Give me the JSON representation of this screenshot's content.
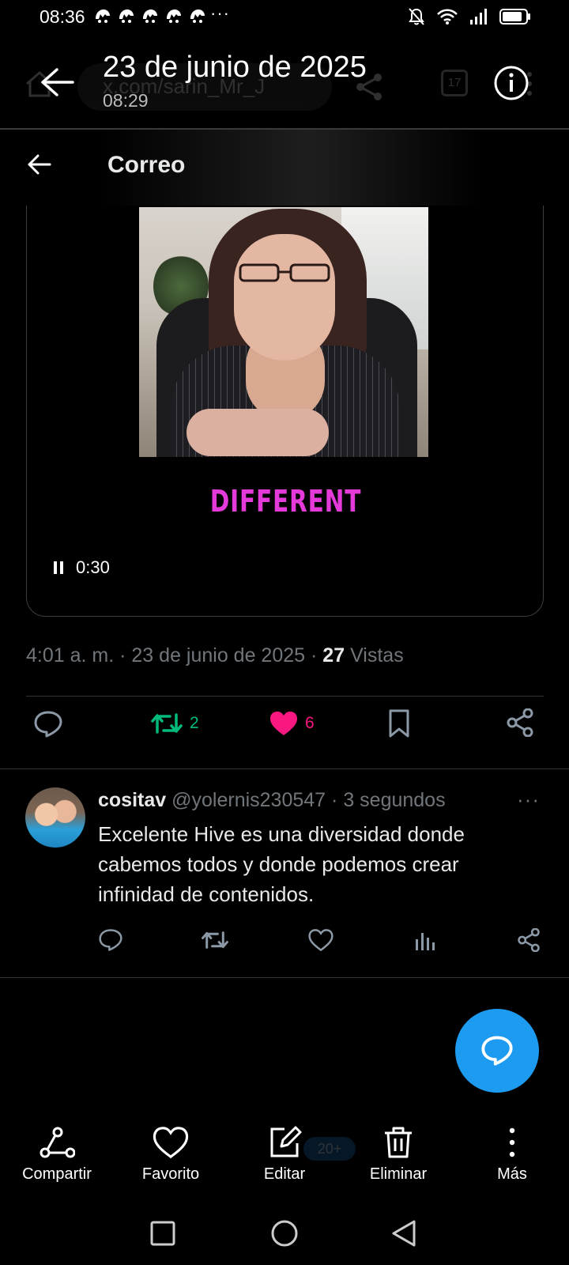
{
  "status_bar": {
    "time": "08:36",
    "more": "···"
  },
  "gallery_header": {
    "date": "23 de junio de 2025",
    "time": "08:29",
    "ghost_url": "x.com/sarin_Mr_J",
    "ghost_tab_count": "17"
  },
  "correo_bar": {
    "title": "Correo"
  },
  "video": {
    "caption": "DIFFERENT",
    "time": "0:30",
    "caption_color": "#e33ad9"
  },
  "tweet_meta": {
    "time": "4:01 a. m.",
    "separator": "·",
    "date": "23 de junio de 2025",
    "views_count": "27",
    "views_label": "Vistas"
  },
  "actions": {
    "retweets": "2",
    "likes": "6",
    "retweet_color": "#00ba7c",
    "like_color": "#f91880"
  },
  "reply": {
    "name": "cositav",
    "handle": "@yolernis230547",
    "separator": "·",
    "time": "3 segundos",
    "more": "···",
    "text": "Excelente Hive es una diversidad donde cabemos todos y donde podemos crear infinidad de contenidos."
  },
  "ghost_nav": {
    "badge": "20+"
  },
  "toolbar": {
    "share": "Compartir",
    "favorite": "Favorito",
    "edit": "Editar",
    "delete": "Eliminar",
    "more": "Más"
  },
  "colors": {
    "accent": "#1d9bf0",
    "background": "#000000",
    "text": "#e7e9ea",
    "muted": "#71767b"
  }
}
